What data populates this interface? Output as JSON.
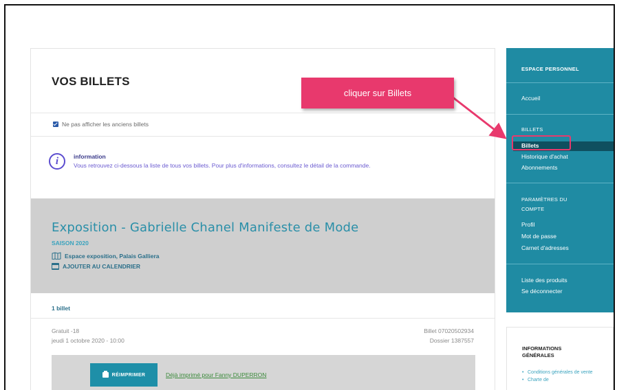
{
  "main": {
    "title": "VOS BILLETS",
    "hide_old_label": "Ne pas afficher les anciens billets",
    "info": {
      "title": "information",
      "body": "Vous retrouvez ci-dessous la liste de tous vos billets. Pour plus d'informations, consultez le détail de la commande."
    },
    "event": {
      "title": "Exposition - Gabrielle Chanel Manifeste de Mode",
      "season": "SAISON 2020",
      "place": "Espace exposition, Palais Galliera",
      "calendar": "AJOUTER AU CALENDRIER"
    },
    "tickets_count": "1 billet",
    "ticket": {
      "type": "Gratuit -18",
      "date": "jeudi 1 octobre 2020 - 10:00",
      "number": "Billet 07020502934",
      "dossier": "Dossier 1387557"
    },
    "reprint_label": "RÉIMPRIMER",
    "reprint_note": "Déjà imprimé pour Fanny DUPERRON"
  },
  "callout": {
    "text": "cliquer sur Billets",
    "color": "#e8396d"
  },
  "sidebar": {
    "heading": "ESPACE PERSONNEL",
    "accueil": "Accueil",
    "billets_section": "BILLETS",
    "billets_active": "Billets",
    "historique": "Historique d'achat",
    "abonnements": "Abonnements",
    "params_section_1": "PARAMÈTRES DU",
    "params_section_2": "COMPTE",
    "profil": "Profil",
    "mdp": "Mot de passe",
    "carnet": "Carnet d'adresses",
    "produits": "Liste des produits",
    "deconnecter": "Se déconnecter",
    "color": "#1f8ba3"
  },
  "info_panel": {
    "title": "INFORMATIONS GÉNÉRALES",
    "items": [
      "Conditions générales de vente",
      "Charte de"
    ]
  }
}
